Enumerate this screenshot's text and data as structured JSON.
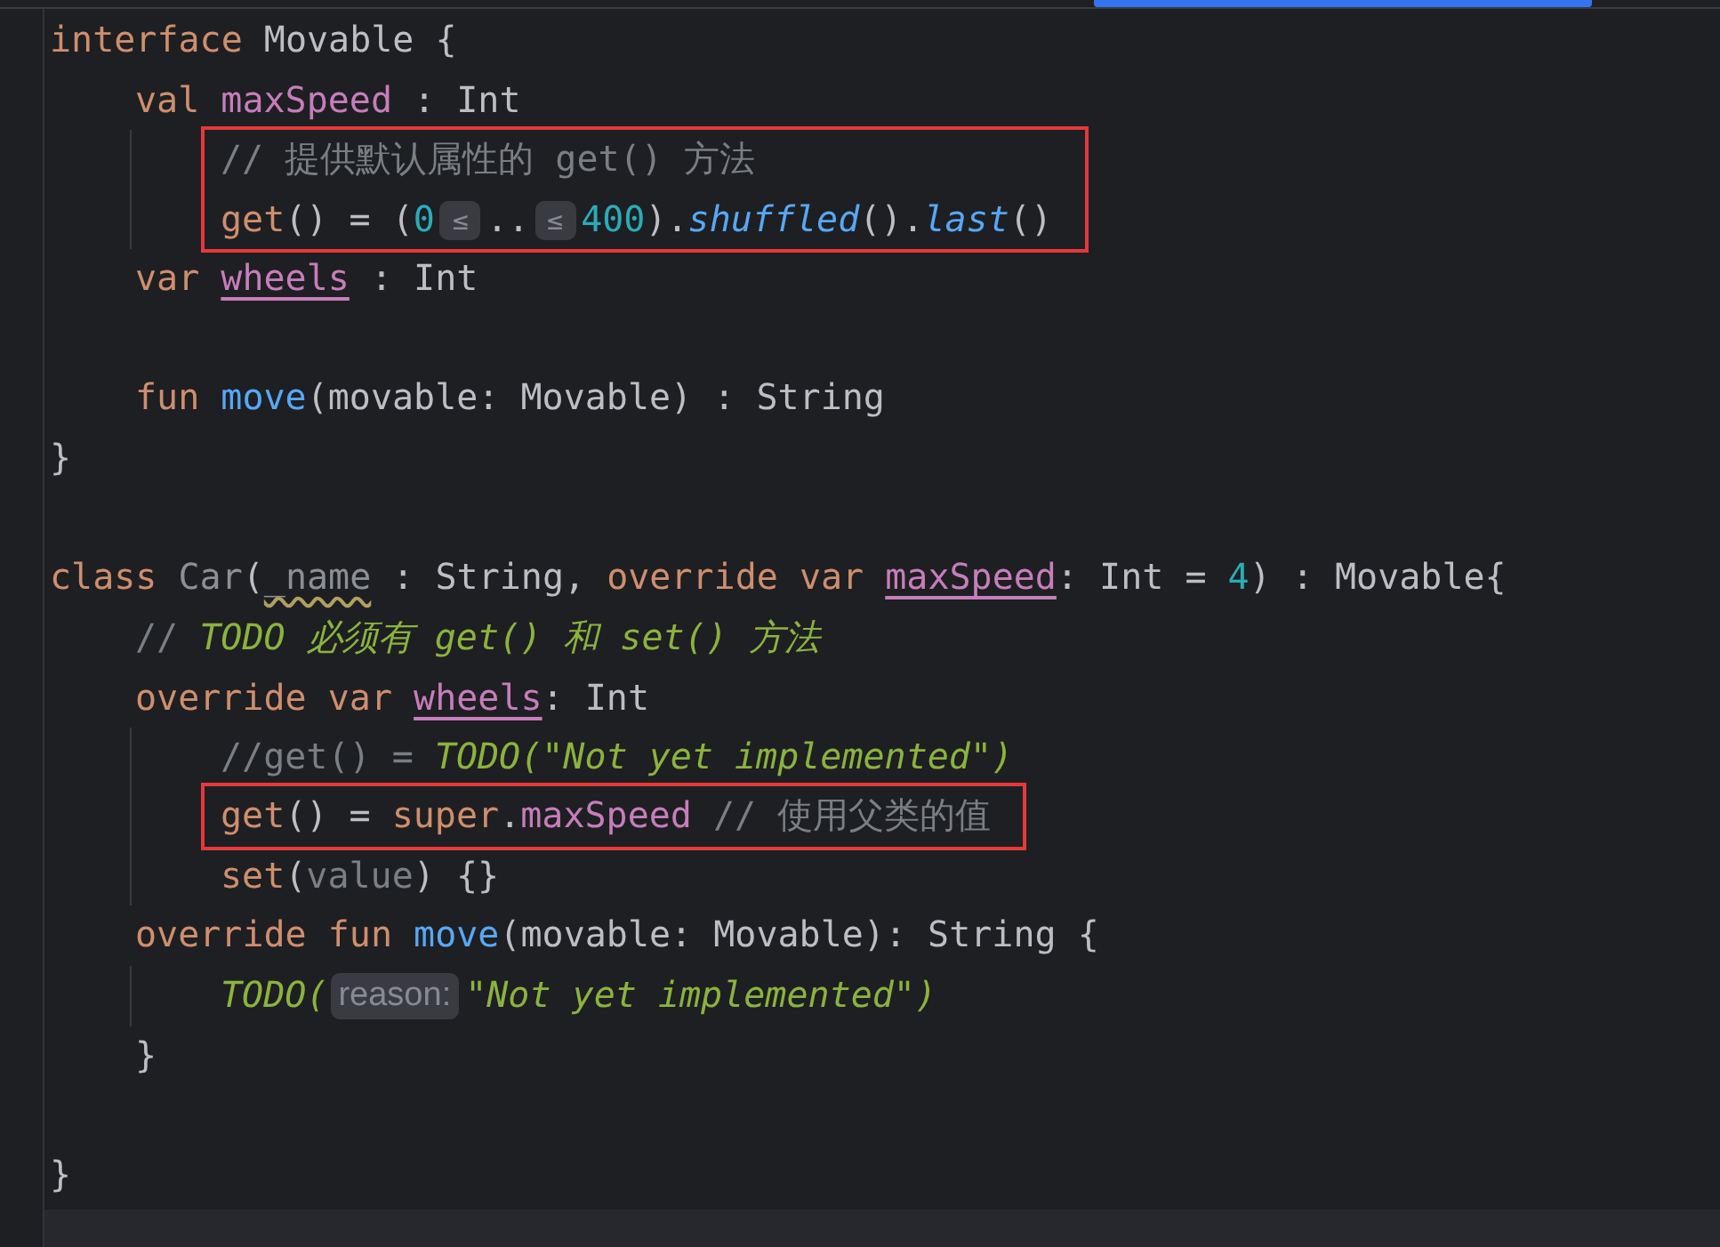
{
  "editor": {
    "lines": [
      {
        "kind": "code",
        "tokens": [
          {
            "kind": "kw",
            "text": "interface "
          },
          {
            "kind": "plain",
            "text": "Movable {"
          }
        ],
        "children": [
          {
            "kind": "code",
            "tokens": [
              {
                "kind": "kw",
                "text": "val "
              },
              {
                "kind": "prop",
                "text": "maxSpeed"
              },
              {
                "kind": "plain",
                "text": " : Int"
              }
            ],
            "children": [
              {
                "kind": "highlight",
                "children": [
                  {
                    "kind": "code",
                    "tokens": [
                      {
                        "kind": "comment",
                        "text": "// 提供默认属性的 get() 方法"
                      }
                    ]
                  },
                  {
                    "kind": "code",
                    "tokens": [
                      {
                        "kind": "kw",
                        "text": "get"
                      },
                      {
                        "kind": "plain",
                        "text": "() = ("
                      },
                      {
                        "kind": "num",
                        "text": "0"
                      },
                      {
                        "kind": "hint",
                        "text": "≤"
                      },
                      {
                        "kind": "plain",
                        "text": ".."
                      },
                      {
                        "kind": "hint",
                        "text": "≤"
                      },
                      {
                        "kind": "num",
                        "text": "400"
                      },
                      {
                        "kind": "plain",
                        "text": ")."
                      },
                      {
                        "kind": "ext",
                        "text": "shuffled"
                      },
                      {
                        "kind": "plain",
                        "text": "()."
                      },
                      {
                        "kind": "ext",
                        "text": "last"
                      },
                      {
                        "kind": "plain",
                        "text": "()"
                      }
                    ]
                  }
                ]
              }
            ]
          },
          {
            "kind": "code",
            "tokens": [
              {
                "kind": "kw",
                "text": "var "
              },
              {
                "kind": "varprop",
                "text": "wheels"
              },
              {
                "kind": "plain",
                "text": " : Int"
              }
            ]
          },
          {
            "kind": "blank"
          },
          {
            "kind": "code",
            "tokens": [
              {
                "kind": "kw",
                "text": "fun "
              },
              {
                "kind": "func",
                "text": "move"
              },
              {
                "kind": "plain",
                "text": "(movable: Movable) : String"
              }
            ]
          }
        ]
      },
      {
        "kind": "code",
        "tokens": [
          {
            "kind": "plain",
            "text": "}"
          }
        ]
      },
      {
        "kind": "blank"
      },
      {
        "kind": "code",
        "tokens": [
          {
            "kind": "kw",
            "text": "class "
          },
          {
            "kind": "unused",
            "text": "Car"
          },
          {
            "kind": "plain",
            "text": "("
          },
          {
            "kind": "warn",
            "text": "_name"
          },
          {
            "kind": "plain",
            "text": " : String, "
          },
          {
            "kind": "kw",
            "text": "override var "
          },
          {
            "kind": "varprop",
            "text": "maxSpeed"
          },
          {
            "kind": "plain",
            "text": ": Int = "
          },
          {
            "kind": "num",
            "text": "4"
          },
          {
            "kind": "plain",
            "text": ") : Movable{"
          }
        ],
        "children": [
          {
            "kind": "code",
            "tokens": [
              {
                "kind": "comment",
                "text": "// "
              },
              {
                "kind": "todo",
                "text": "TODO 必须有 get() 和 set() 方法"
              }
            ]
          },
          {
            "kind": "code",
            "tokens": [
              {
                "kind": "kw",
                "text": "override var "
              },
              {
                "kind": "varprop",
                "text": "wheels"
              },
              {
                "kind": "plain",
                "text": ": Int"
              }
            ],
            "children": [
              {
                "kind": "code",
                "tokens": [
                  {
                    "kind": "comment",
                    "text": "//get() = "
                  },
                  {
                    "kind": "todo",
                    "text": "TODO(\"Not yet implemented\")"
                  }
                ]
              },
              {
                "kind": "highlight",
                "children": [
                  {
                    "kind": "code",
                    "tokens": [
                      {
                        "kind": "kw",
                        "text": "get"
                      },
                      {
                        "kind": "plain",
                        "text": "() = "
                      },
                      {
                        "kind": "kw",
                        "text": "super"
                      },
                      {
                        "kind": "plain",
                        "text": "."
                      },
                      {
                        "kind": "prop",
                        "text": "maxSpeed"
                      },
                      {
                        "kind": "comment",
                        "text": " // 使用父类的值"
                      }
                    ]
                  }
                ]
              },
              {
                "kind": "code",
                "tokens": [
                  {
                    "kind": "kw",
                    "text": "set"
                  },
                  {
                    "kind": "plain",
                    "text": "("
                  },
                  {
                    "kind": "param",
                    "text": "value"
                  },
                  {
                    "kind": "plain",
                    "text": ") {}"
                  }
                ]
              }
            ]
          },
          {
            "kind": "code",
            "tokens": [
              {
                "kind": "kw",
                "text": "override fun "
              },
              {
                "kind": "func",
                "text": "move"
              },
              {
                "kind": "plain",
                "text": "(movable: Movable): String {"
              }
            ],
            "children": [
              {
                "kind": "code",
                "tokens": [
                  {
                    "kind": "todo",
                    "text": "TODO("
                  },
                  {
                    "kind": "hint",
                    "text": "reason:"
                  },
                  {
                    "kind": "todo",
                    "text": "\"Not yet implemented\")"
                  }
                ]
              }
            ]
          },
          {
            "kind": "code",
            "tokens": [
              {
                "kind": "plain",
                "text": "}"
              }
            ]
          },
          {
            "kind": "blank"
          }
        ]
      },
      {
        "kind": "code",
        "tokens": [
          {
            "kind": "plain",
            "text": "}"
          }
        ]
      }
    ]
  }
}
